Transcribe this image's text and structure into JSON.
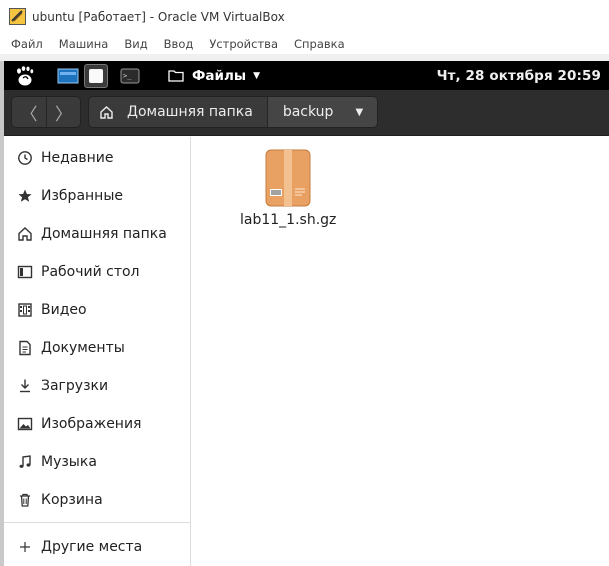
{
  "host_window": {
    "title": "ubuntu [Работает] - Oracle VM VirtualBox",
    "menu": [
      "Файл",
      "Машина",
      "Вид",
      "Ввод",
      "Устройства",
      "Справка"
    ]
  },
  "top_panel": {
    "app_menu_label": "Файлы",
    "clock": "Чт, 28 октября  20:59"
  },
  "headerbar": {
    "back_icon": "chevron-left-icon",
    "forward_icon": "chevron-right-icon",
    "path": {
      "home_label": "Домашняя папка",
      "current_label": "backup"
    }
  },
  "sidebar": {
    "items": [
      {
        "label": "Недавние",
        "icon": "clock-icon"
      },
      {
        "label": "Избранные",
        "icon": "star-icon"
      },
      {
        "label": "Домашняя папка",
        "icon": "home-icon"
      },
      {
        "label": "Рабочий стол",
        "icon": "desktop-icon"
      },
      {
        "label": "Видео",
        "icon": "video-icon"
      },
      {
        "label": "Документы",
        "icon": "document-icon"
      },
      {
        "label": "Загрузки",
        "icon": "download-icon"
      },
      {
        "label": "Изображения",
        "icon": "image-icon"
      },
      {
        "label": "Музыка",
        "icon": "music-icon"
      },
      {
        "label": "Корзина",
        "icon": "trash-icon"
      }
    ],
    "other_locations": {
      "label": "Другие места",
      "icon": "plus-icon"
    }
  },
  "files": [
    {
      "name": "lab11_1.sh.gz",
      "icon": "archive-icon"
    }
  ],
  "colors": {
    "panel_bg": "#000000",
    "headerbar_bg": "#2d2d2d",
    "archive_orange": "#e8a063"
  }
}
